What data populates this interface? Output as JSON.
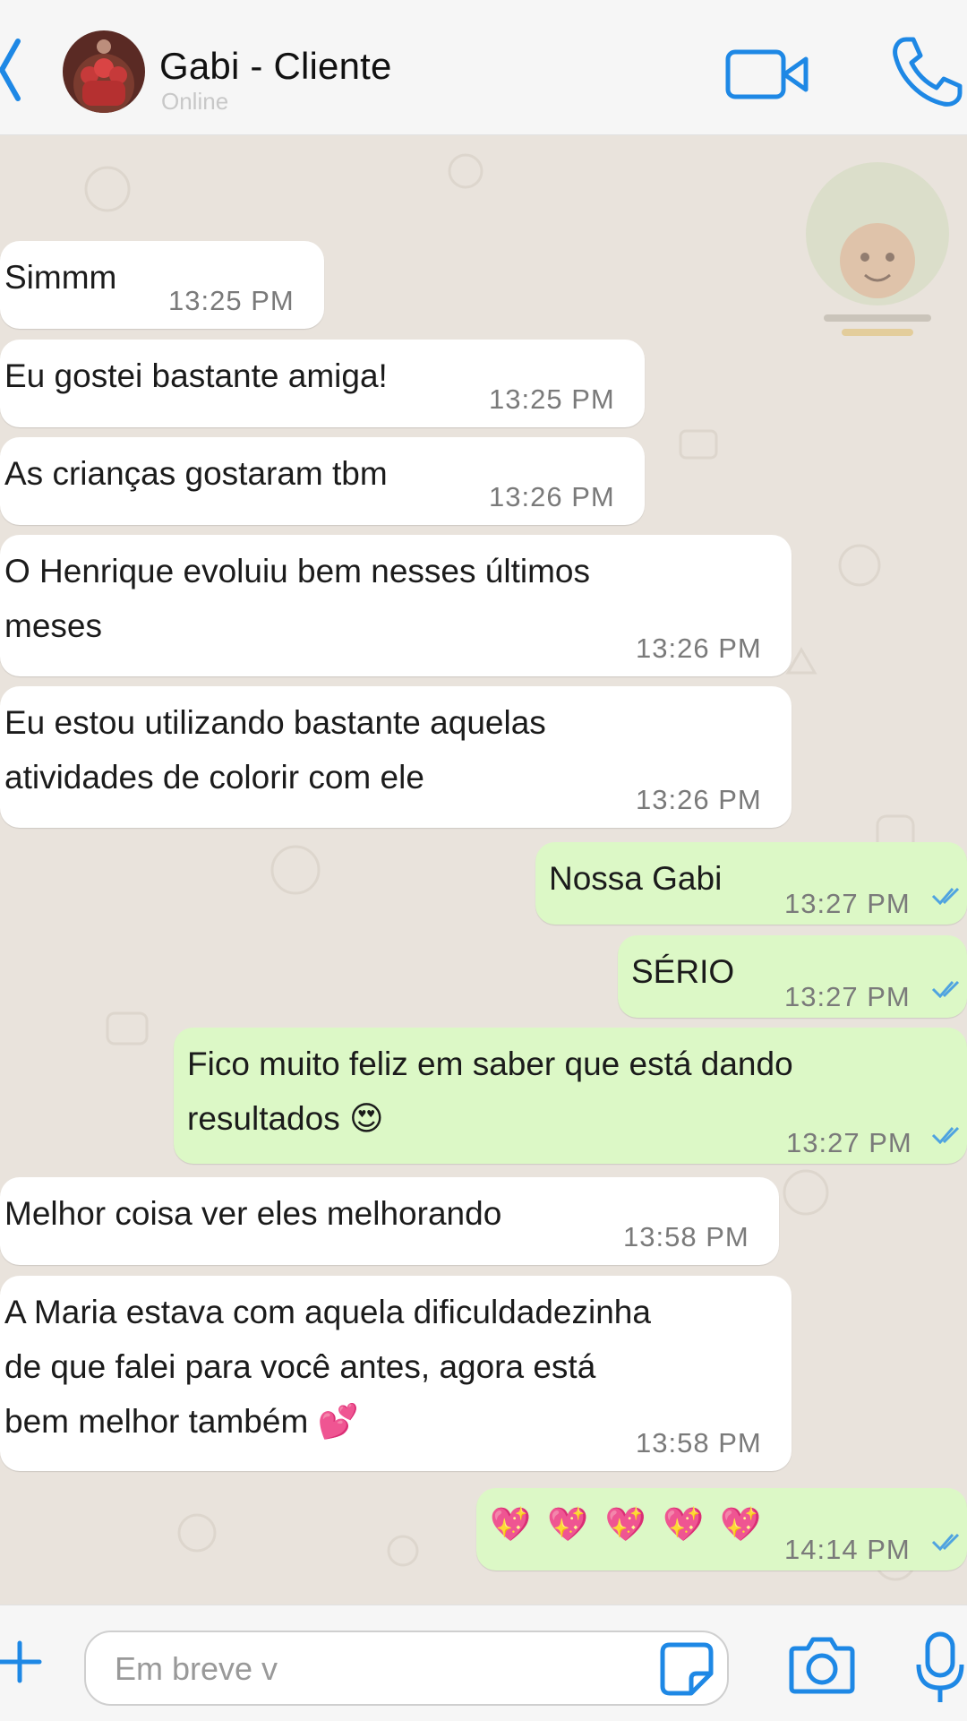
{
  "header": {
    "contact_name": "Gabi - Cliente",
    "status": "Online"
  },
  "messages": [
    {
      "direction": "in",
      "text": "Simmm",
      "time": "13:25 PM"
    },
    {
      "direction": "in",
      "text": "Eu gostei bastante amiga!",
      "time": "13:25 PM"
    },
    {
      "direction": "in",
      "text": "As crianças gostaram tbm",
      "time": "13:26 PM"
    },
    {
      "direction": "in",
      "lines": [
        "O Henrique evoluiu bem nesses últimos",
        "meses"
      ],
      "time": "13:26 PM"
    },
    {
      "direction": "in",
      "lines": [
        "Eu estou utilizando bastante aquelas",
        "atividades de colorir com ele"
      ],
      "time": "13:26 PM"
    },
    {
      "direction": "out",
      "text": "Nossa Gabi",
      "time": "13:27 PM",
      "read": true
    },
    {
      "direction": "out",
      "text": "SÉRIO",
      "time": "13:27 PM",
      "read": true
    },
    {
      "direction": "out",
      "lines": [
        "Fico muito feliz em saber que está dando",
        "resultados 😍"
      ],
      "time": "13:27 PM",
      "read": true
    },
    {
      "direction": "in",
      "text": "Melhor coisa ver eles melhorando",
      "time": "13:58 PM"
    },
    {
      "direction": "in",
      "lines": [
        "A Maria estava com aquela dificuldadezinha",
        "de que falei para você antes, agora está",
        "bem melhor também 💕"
      ],
      "time": "13:58 PM"
    },
    {
      "direction": "out",
      "text": "💖 💖 💖 💖 💖",
      "time": "14:14 PM",
      "read": true
    }
  ],
  "input": {
    "value": "Em breve v"
  },
  "colors": {
    "accent": "#1e88e5",
    "outgoing_bubble": "#dcf8c6",
    "incoming_bubble": "#ffffff",
    "chat_background": "#e9e3dc",
    "read_ticks": "#4fa3e0"
  }
}
